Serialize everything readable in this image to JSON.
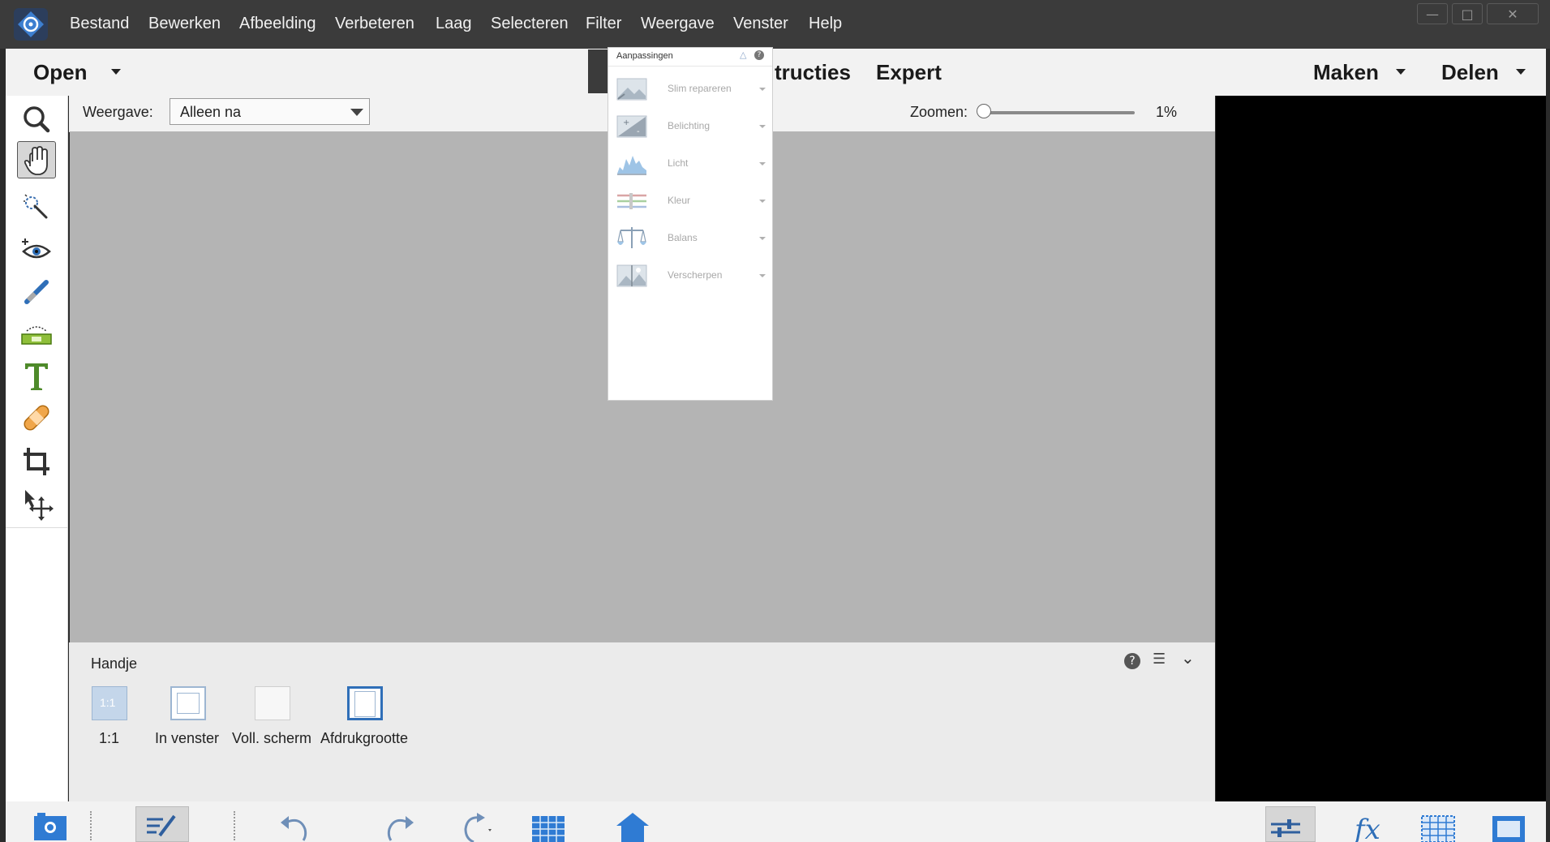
{
  "menubar": {
    "items": [
      "Bestand",
      "Bewerken",
      "Afbeelding",
      "Verbeteren",
      "Laag",
      "Selecteren",
      "Filter",
      "Weergave",
      "Venster",
      "Help"
    ],
    "window_controls": [
      "minimize-icon",
      "restore-icon",
      "close-icon"
    ]
  },
  "modebar": {
    "open_label": "Open",
    "mode_partial": "tructies",
    "mode_expert": "Expert",
    "make_label": "Maken",
    "share_label": "Delen"
  },
  "tools": [
    "zoom-icon",
    "hand-icon",
    "quick-select-icon",
    "eye-icon",
    "brush-icon",
    "level-icon",
    "type-icon",
    "healing-icon",
    "crop-icon",
    "move-icon"
  ],
  "options": {
    "view_label": "Weergave:",
    "view_value": "Alleen na",
    "zoom_label": "Zoomen:",
    "zoom_value": "1%",
    "zoom_level_percent": 1
  },
  "adjustments": {
    "title": "Aanpassingen",
    "items": [
      {
        "label": "Slim repareren",
        "icon": "smart-fix-icon"
      },
      {
        "label": "Belichting",
        "icon": "exposure-icon"
      },
      {
        "label": "Licht",
        "icon": "lighting-icon"
      },
      {
        "label": "Kleur",
        "icon": "color-icon"
      },
      {
        "label": "Balans",
        "icon": "balance-icon"
      },
      {
        "label": "Verscherpen",
        "icon": "sharpen-icon"
      }
    ]
  },
  "tool_options": {
    "title": "Handje",
    "presets": [
      {
        "label": "1:1",
        "icon_text": "1:1"
      },
      {
        "label": "In venster"
      },
      {
        "label": "Voll. scherm"
      },
      {
        "label": "Afdrukgrootte"
      }
    ]
  },
  "taskbar": {
    "icons": [
      "photo-bin-icon",
      "tool-options-icon",
      "undo-icon",
      "redo-icon",
      "rotate-icon",
      "layout-icon",
      "organizer-icon",
      "adjustments-icon",
      "effects-icon",
      "textures-icon",
      "frames-icon"
    ]
  },
  "colors": {
    "menubar_bg": "#3b3b3b",
    "canvas_bg": "#b4b4b4",
    "accent_blue": "#2f7bd3"
  }
}
